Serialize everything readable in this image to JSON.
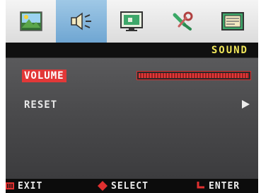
{
  "tabs": [
    {
      "icon": "picture-icon",
      "active": false
    },
    {
      "icon": "speaker-icon",
      "active": true
    },
    {
      "icon": "display-position-icon",
      "active": false
    },
    {
      "icon": "setup-tools-icon",
      "active": false
    },
    {
      "icon": "osd-window-icon",
      "active": false
    }
  ],
  "header": {
    "title": "SOUND"
  },
  "menu": {
    "items": [
      {
        "label": "VOLUME",
        "selected": true,
        "control": "slider",
        "level": 1.0
      },
      {
        "label": "RESET",
        "selected": false,
        "control": "submenu-arrow"
      }
    ]
  },
  "footer": {
    "exit": {
      "label": "EXIT",
      "icon": "menu-icon"
    },
    "select": {
      "label": "SELECT",
      "icon": "diamond-icon"
    },
    "enter": {
      "label": "ENTER",
      "icon": "return-arrow-icon"
    }
  },
  "colors": {
    "accent": "#e23838",
    "title": "#f2e85a",
    "active_tab": "#8dbbe0",
    "panel": "#4a4a4c"
  }
}
